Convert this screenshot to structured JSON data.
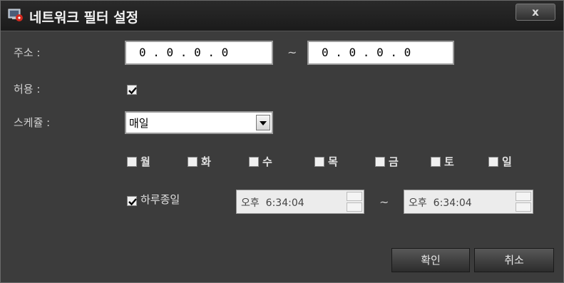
{
  "window": {
    "title": "네트워크 필터 설정",
    "close_label": "x"
  },
  "form": {
    "address_label": "주소 :",
    "ip_start": "0 . 0 . 0 . 0",
    "ip_separator": "~",
    "ip_end": "0 . 0 . 0 . 0",
    "allow_label": "허용 :",
    "allow_checked": true,
    "schedule_label": "스케쥴 :",
    "schedule_value": "매일",
    "days": [
      {
        "label": "월",
        "checked": false
      },
      {
        "label": "화",
        "checked": false
      },
      {
        "label": "수",
        "checked": false
      },
      {
        "label": "목",
        "checked": false
      },
      {
        "label": "금",
        "checked": false
      },
      {
        "label": "토",
        "checked": false
      },
      {
        "label": "일",
        "checked": false
      }
    ],
    "all_day_label": "하루종일",
    "all_day_checked": true,
    "time_start": "오후  6:34:04",
    "time_separator": "~",
    "time_end": "오후  6:34:04"
  },
  "buttons": {
    "ok": "확인",
    "cancel": "취소"
  },
  "colors": {
    "background": "#3c3c3c",
    "titlebar": "#1b1b1b",
    "text": "#d0d0d0",
    "input": "#ffffff"
  }
}
